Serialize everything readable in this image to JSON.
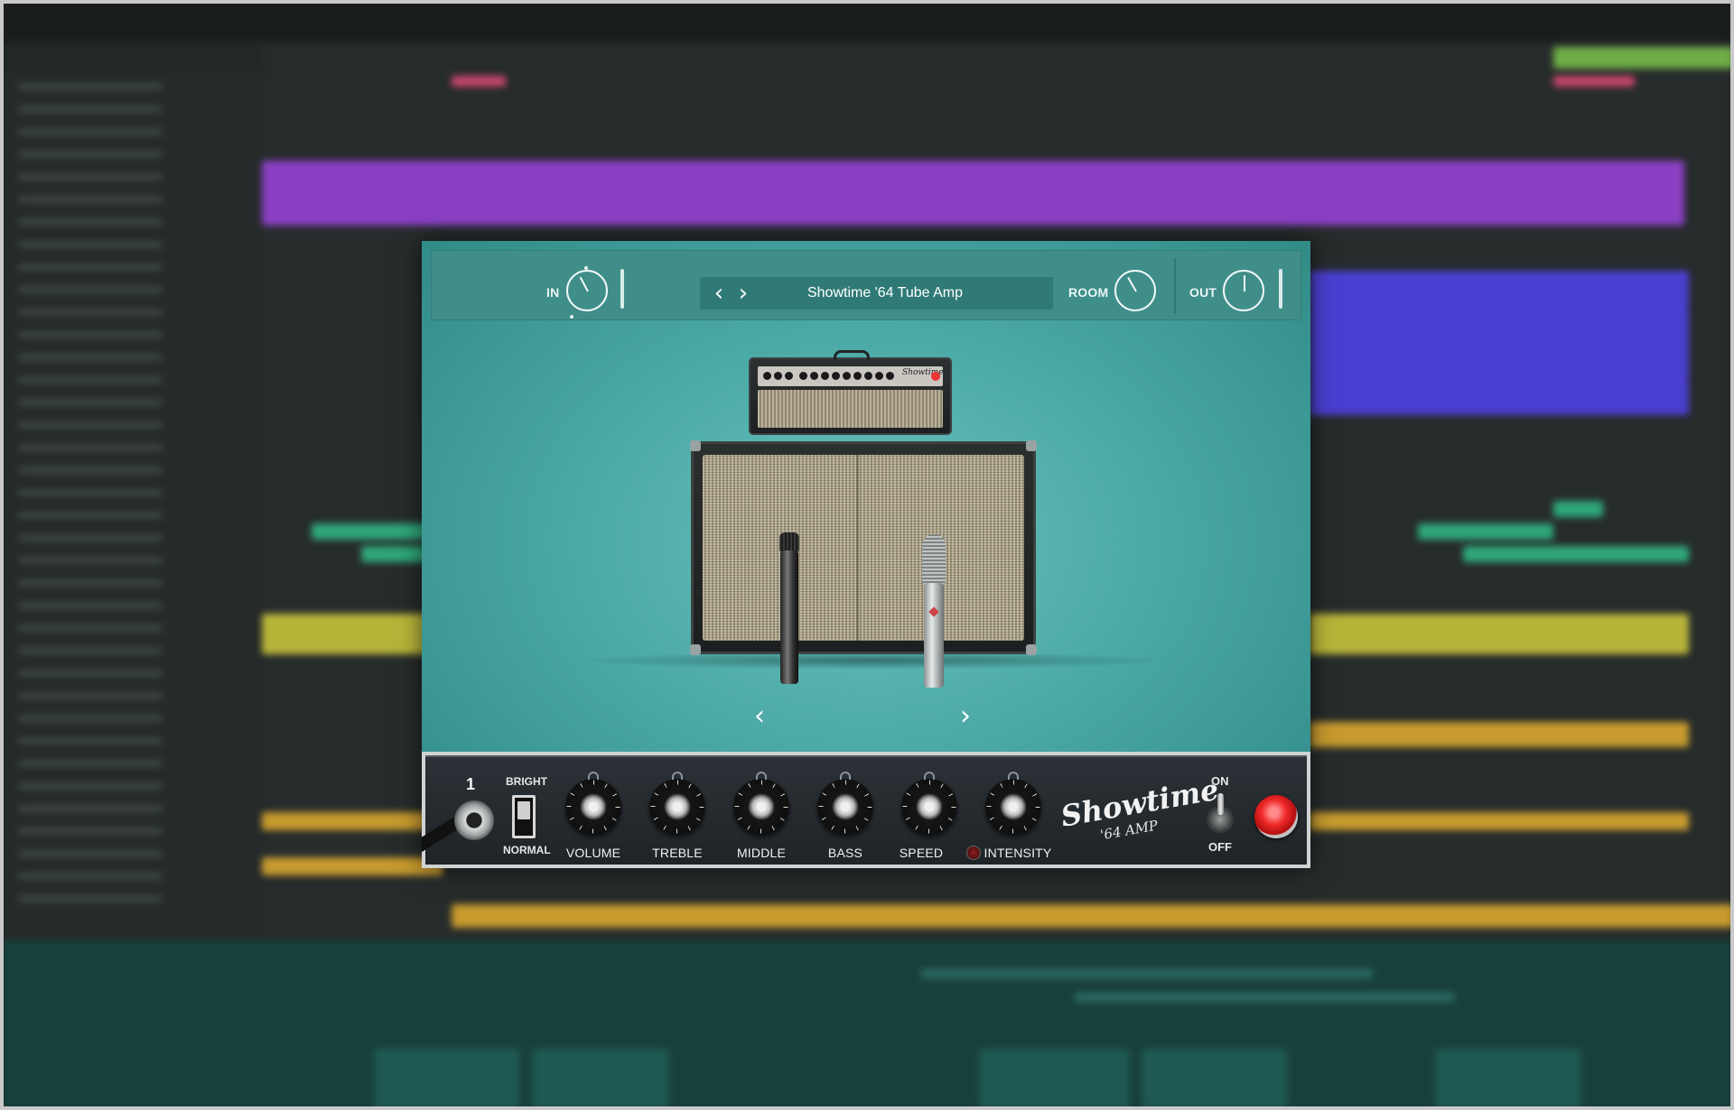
{
  "header": {
    "in_label": "IN",
    "room_label": "ROOM",
    "out_label": "OUT",
    "preset": {
      "prev_icon": "chevron-left",
      "next_icon": "chevron-right",
      "name": "Showtime '64 Tube Amp"
    }
  },
  "scene": {
    "prev_mic_icon": "chevron-left",
    "next_mic_icon": "chevron-right",
    "amp_brand": "Showtime"
  },
  "controls": {
    "input_number": "1",
    "bright_label": "BRIGHT",
    "normal_label": "NORMAL",
    "knobs": [
      {
        "label": "VOLUME"
      },
      {
        "label": "TREBLE"
      },
      {
        "label": "MIDDLE"
      },
      {
        "label": "BASS"
      },
      {
        "label": "SPEED"
      },
      {
        "label": "INTENSITY"
      }
    ],
    "brand_script": "Showtime",
    "brand_model": "'64 AMP",
    "power_on_label": "ON",
    "power_off_label": "OFF"
  },
  "colors": {
    "plugin_teal": "#4ba9a6",
    "header_teal": "#3f8e8a",
    "strip_dark": "#23292d",
    "power_lamp": "#f02a2a"
  }
}
